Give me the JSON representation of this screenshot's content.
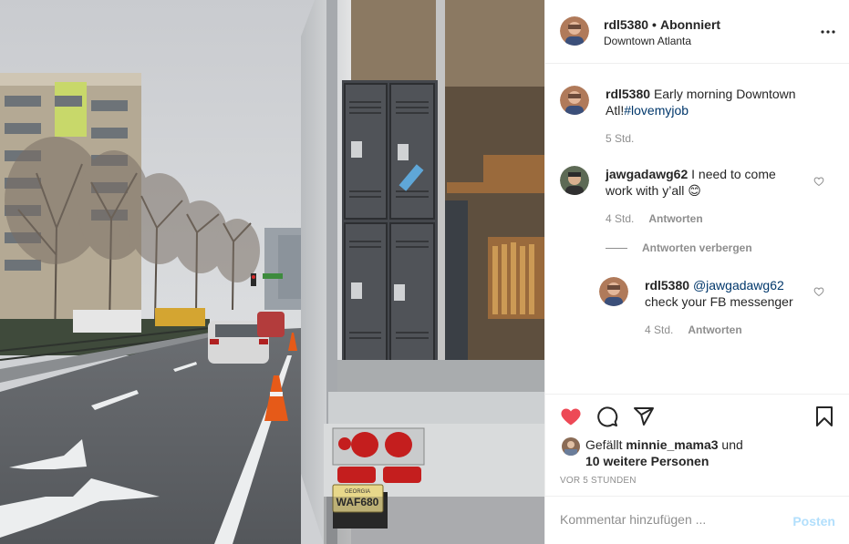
{
  "post": {
    "username": "rdl5380",
    "separator": "•",
    "follow_status": "Abonniert",
    "location": "Downtown Atlanta",
    "truck_plate": "WAF680",
    "truck_plate_state": "GEORGIA"
  },
  "caption": {
    "username": "rdl5380",
    "text": "Early morning Downtown Atl!",
    "hashtag": "#lovemyjob",
    "time": "5 Std."
  },
  "comments": [
    {
      "username": "jawgadawg62",
      "text": "I need to come work with y’all",
      "emoji": "😊",
      "time": "4 Std.",
      "reply_label": "Antworten"
    }
  ],
  "hide_replies_label": "Antworten verbergen",
  "replies": [
    {
      "username": "rdl5380",
      "mention": "@jawgadawg62",
      "text": "check your FB messenger",
      "time": "4 Std.",
      "reply_label": "Antworten"
    }
  ],
  "likes": {
    "prefix": "Gefällt",
    "liker": "minnie_mama3",
    "conjunction": "und",
    "others": "10 weitere Personen"
  },
  "timestamp": "VOR 5 STUNDEN",
  "comment_box": {
    "placeholder": "Kommentar hinzufügen ...",
    "post_label": "Posten"
  },
  "colors": {
    "like_red": "#ed4956",
    "link_blue": "#00376b",
    "post_disabled": "#b2dffc",
    "secondary_text": "#8e8e8e"
  },
  "icons": [
    "more-icon",
    "heart-icon",
    "comment-icon",
    "share-icon",
    "bookmark-icon",
    "heart-outline-icon"
  ]
}
